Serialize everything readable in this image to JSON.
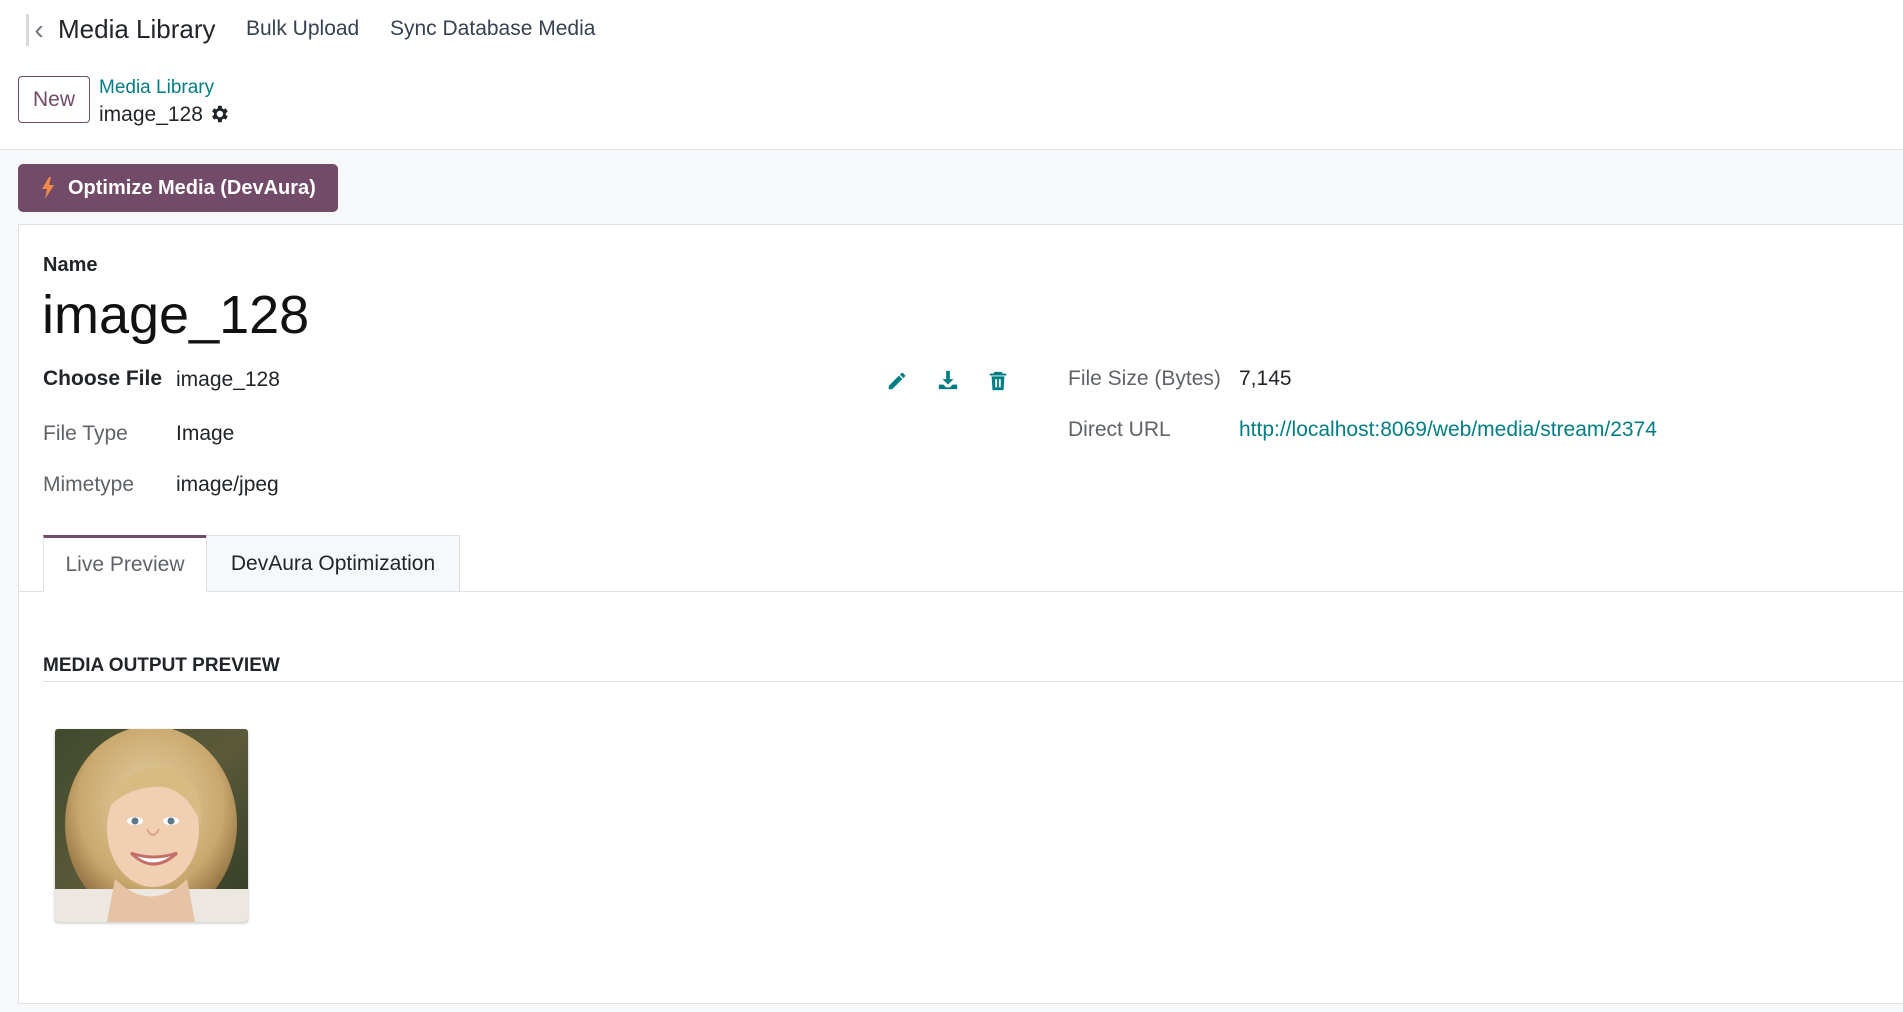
{
  "nav": {
    "app_title": "Media Library",
    "menu": [
      "Bulk Upload",
      "Sync Database Media"
    ]
  },
  "control_panel": {
    "new_label": "New",
    "breadcrumb_parent": "Media Library",
    "breadcrumb_current": "image_128"
  },
  "actions": {
    "optimize_label": "Optimize Media (DevAura)"
  },
  "form": {
    "name_label": "Name",
    "name_value": "image_128",
    "choose_file_label": "Choose File",
    "choose_file_value": "image_128",
    "file_type_label": "File Type",
    "file_type_value": "Image",
    "mimetype_label": "Mimetype",
    "mimetype_value": "image/jpeg",
    "file_size_label": "File Size (Bytes)",
    "file_size_value": "7,145",
    "direct_url_label": "Direct URL",
    "direct_url_value": "http://localhost:8069/web/media/stream/2374"
  },
  "tabs": [
    "Live Preview",
    "DevAura Optimization"
  ],
  "preview": {
    "section_title": "MEDIA OUTPUT PREVIEW"
  },
  "colors": {
    "brand": "#714b67",
    "link": "#017e84",
    "accent_bolt": "#f08a4b"
  },
  "icons": [
    "chevron-left-icon",
    "gear-icon",
    "bolt-icon",
    "pencil-icon",
    "download-icon",
    "trash-icon"
  ]
}
